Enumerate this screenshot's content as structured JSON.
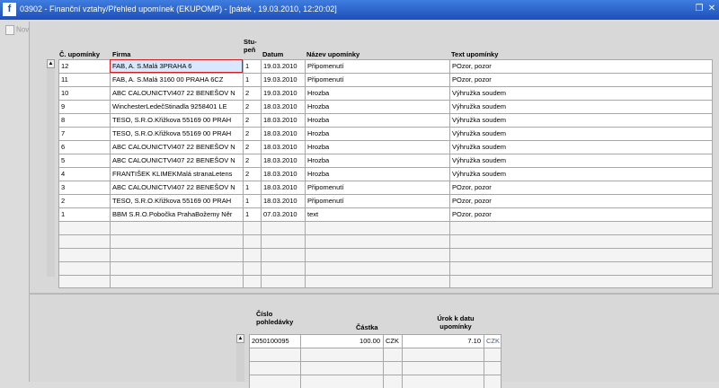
{
  "window": {
    "app_icon": "f",
    "title": "03902 - Finanční vztahy/Přehled upomínek (EKUPOMP) - [pátek , 19.03.2010, 12:20:02]",
    "restore_icon": "restore-icon",
    "close_icon": "close-icon"
  },
  "toolbar": {
    "new_label": "Nov"
  },
  "upominky": {
    "headers": {
      "cislo": "Č. upomínky",
      "firma": "Firma",
      "stupen_1": "Stu-",
      "stupen_2": "peň",
      "datum": "Datum",
      "nazev": "Název upomínky",
      "text": "Text upomínky"
    },
    "rows": [
      [
        "12",
        "FAB, A. S.Malá 3PRAHA 6",
        "1",
        "19.03.2010",
        "Připomenutí",
        "POzor, pozor"
      ],
      [
        "11",
        "FAB, A. S.Malá 3160 00 PRAHA 6CZ",
        "1",
        "19.03.2010",
        "Připomenutí",
        "POzor, pozor"
      ],
      [
        "10",
        "ABC CALOUNICTVI407 22 BENEŠOV N",
        "2",
        "19.03.2010",
        "Hrozba",
        "Výhružka soudem"
      ],
      [
        "9",
        "WinchesterLedečStinadla 9258401 LE",
        "2",
        "18.03.2010",
        "Hrozba",
        "Výhružka soudem"
      ],
      [
        "8",
        "TESO, S.R.O.Křižkova 55169 00 PRAH",
        "2",
        "18.03.2010",
        "Hrozba",
        "Výhružka soudem"
      ],
      [
        "7",
        "TESO, S.R.O.Křižkova 55169 00 PRAH",
        "2",
        "18.03.2010",
        "Hrozba",
        "Výhružka soudem"
      ],
      [
        "6",
        "ABC CALOUNICTVI407 22 BENEŠOV N",
        "2",
        "18.03.2010",
        "Hrozba",
        "Výhružka soudem"
      ],
      [
        "5",
        "ABC CALOUNICTVI407 22 BENEŠOV N",
        "2",
        "18.03.2010",
        "Hrozba",
        "Výhružka soudem"
      ],
      [
        "4",
        "FRANTIŠEK KLIMEKMalá stranaLetens",
        "2",
        "18.03.2010",
        "Hrozba",
        "Výhružka soudem"
      ],
      [
        "3",
        "ABC CALOUNICTVI407 22 BENEŠOV N",
        "1",
        "18.03.2010",
        "Připomenutí",
        "POzor, pozor"
      ],
      [
        "2",
        "TESO, S.R.O.Křižkova 55169 00 PRAH",
        "1",
        "18.03.2010",
        "Připomenutí",
        "POzor, pozor"
      ],
      [
        "1",
        "BBM S.R.O.Pobočka PrahaBožemy Něr",
        "1",
        "07.03.2010",
        "text",
        "POzor, pozor"
      ]
    ],
    "empty_rows": 5
  },
  "pohledavky": {
    "headers": {
      "cislo_1": "Číslo",
      "cislo_2": "pohledávky",
      "castka": "Částka",
      "urok_1": "Úrok k datu",
      "urok_2": "upomínky"
    },
    "rows": [
      [
        "2050100095",
        "100.00",
        "CZK",
        "7.10",
        "CZK"
      ]
    ],
    "empty_rows": 3
  }
}
